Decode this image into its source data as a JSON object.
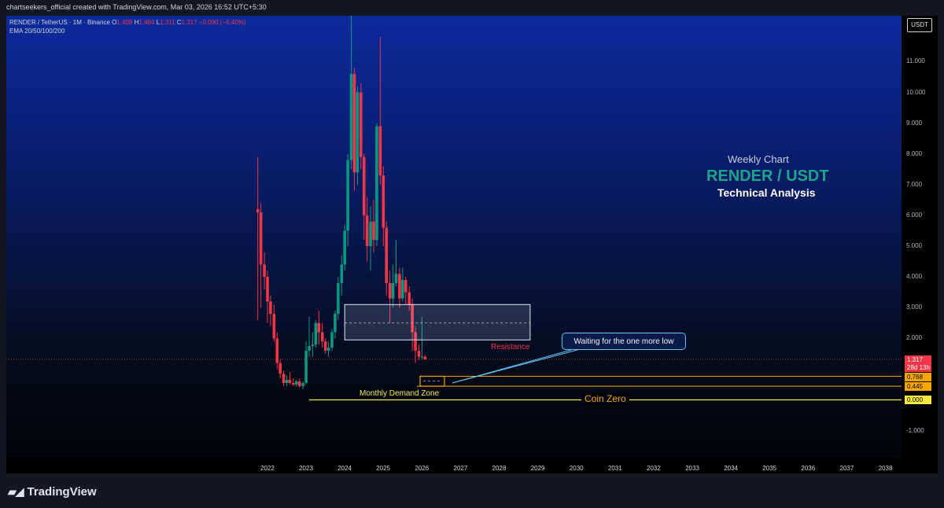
{
  "header": {
    "caption": "chartseekers_official created with TradingView.com, Mar 03, 2026 16:52 UTC+5:30",
    "legend_symbol": "RENDER / TetherUS · 1M · Binance",
    "legend_o": "O",
    "legend_o_val": "1.408",
    "legend_h": "H",
    "legend_h_val": "1.464",
    "legend_l": "L",
    "legend_l_val": "1.311",
    "legend_c": "C",
    "legend_c_val": "1.317 −0.090 (−6.40%)",
    "indicator": "EMA 20/50/100/200"
  },
  "currency_label": "USDT",
  "price_tags": {
    "last_price": "1.317",
    "countdown": "28d 13h",
    "zone_top": "0.768",
    "zone_bottom": "0.445",
    "zero": "0.000"
  },
  "annotations": {
    "weekly": "Weekly Chart",
    "pair": "RENDER / USDT",
    "ta": "Technical Analysis",
    "resistance": "Resistance",
    "callout": "Waiting for the one more low",
    "demand": "Monthly Demand Zone",
    "coin_zero": "Coin Zero"
  },
  "footer": {
    "brand": "TradingView"
  },
  "colors": {
    "up": "#089981",
    "down": "#f23645",
    "zone": "#f7a600",
    "zero_line": "#f5e642",
    "callout_border": "#60c3ef",
    "pair_title": "#1fa38a"
  },
  "chart_data": {
    "type": "candlestick",
    "symbol": "RENDER / TetherUS",
    "interval": "1M",
    "exchange": "Binance",
    "ylim": [
      -1.5,
      12.5
    ],
    "y_ticks": [
      "11.000",
      "10.000",
      "9.000",
      "8.000",
      "7.000",
      "6.000",
      "5.000",
      "4.000",
      "3.000",
      "2.000",
      "-1.000"
    ],
    "x_ticks": [
      "2022",
      "2023",
      "2024",
      "2025",
      "2026",
      "2027",
      "2028",
      "2029",
      "2030",
      "2031",
      "2032",
      "2033",
      "2034",
      "2035",
      "2036",
      "2037",
      "2038"
    ],
    "candles": [
      {
        "t": 2021.75,
        "o": 6.2,
        "h": 7.9,
        "l": 2.6,
        "c": 6.1
      },
      {
        "t": 2021.83,
        "o": 6.1,
        "h": 6.4,
        "l": 3.0,
        "c": 4.4
      },
      {
        "t": 2021.92,
        "o": 4.4,
        "h": 4.8,
        "l": 3.6,
        "c": 4.0
      },
      {
        "t": 2022.0,
        "o": 4.0,
        "h": 4.2,
        "l": 2.5,
        "c": 3.2
      },
      {
        "t": 2022.08,
        "o": 3.2,
        "h": 3.4,
        "l": 2.4,
        "c": 2.8
      },
      {
        "t": 2022.17,
        "o": 2.8,
        "h": 3.1,
        "l": 1.9,
        "c": 2.0
      },
      {
        "t": 2022.25,
        "o": 2.0,
        "h": 2.2,
        "l": 1.0,
        "c": 1.2
      },
      {
        "t": 2022.33,
        "o": 1.2,
        "h": 1.3,
        "l": 0.7,
        "c": 0.85
      },
      {
        "t": 2022.42,
        "o": 0.85,
        "h": 0.95,
        "l": 0.45,
        "c": 0.55
      },
      {
        "t": 2022.5,
        "o": 0.55,
        "h": 0.8,
        "l": 0.45,
        "c": 0.65
      },
      {
        "t": 2022.58,
        "o": 0.65,
        "h": 0.9,
        "l": 0.5,
        "c": 0.55
      },
      {
        "t": 2022.67,
        "o": 0.55,
        "h": 0.7,
        "l": 0.45,
        "c": 0.5
      },
      {
        "t": 2022.75,
        "o": 0.5,
        "h": 0.65,
        "l": 0.42,
        "c": 0.6
      },
      {
        "t": 2022.83,
        "o": 0.6,
        "h": 0.7,
        "l": 0.4,
        "c": 0.45
      },
      {
        "t": 2022.92,
        "o": 0.45,
        "h": 0.6,
        "l": 0.35,
        "c": 0.55
      },
      {
        "t": 2023.0,
        "o": 0.55,
        "h": 1.9,
        "l": 0.5,
        "c": 1.6
      },
      {
        "t": 2023.08,
        "o": 1.6,
        "h": 2.7,
        "l": 1.4,
        "c": 1.75
      },
      {
        "t": 2023.17,
        "o": 1.75,
        "h": 2.2,
        "l": 1.4,
        "c": 1.8
      },
      {
        "t": 2023.25,
        "o": 1.8,
        "h": 2.6,
        "l": 1.7,
        "c": 2.5
      },
      {
        "t": 2023.33,
        "o": 2.5,
        "h": 2.9,
        "l": 1.8,
        "c": 2.2
      },
      {
        "t": 2023.42,
        "o": 2.2,
        "h": 2.5,
        "l": 1.7,
        "c": 1.9
      },
      {
        "t": 2023.5,
        "o": 1.9,
        "h": 2.0,
        "l": 1.5,
        "c": 1.6
      },
      {
        "t": 2023.58,
        "o": 1.6,
        "h": 1.9,
        "l": 1.4,
        "c": 1.7
      },
      {
        "t": 2023.67,
        "o": 1.7,
        "h": 2.3,
        "l": 1.6,
        "c": 2.2
      },
      {
        "t": 2023.75,
        "o": 2.2,
        "h": 2.9,
        "l": 2.0,
        "c": 2.8
      },
      {
        "t": 2023.83,
        "o": 2.8,
        "h": 4.0,
        "l": 2.6,
        "c": 3.8
      },
      {
        "t": 2023.92,
        "o": 3.8,
        "h": 4.7,
        "l": 3.4,
        "c": 4.4
      },
      {
        "t": 2024.0,
        "o": 4.4,
        "h": 5.7,
        "l": 4.2,
        "c": 5.5
      },
      {
        "t": 2024.08,
        "o": 5.5,
        "h": 8.0,
        "l": 5.0,
        "c": 7.8
      },
      {
        "t": 2024.17,
        "o": 7.8,
        "h": 12.5,
        "l": 7.5,
        "c": 10.6
      },
      {
        "t": 2024.25,
        "o": 10.6,
        "h": 10.8,
        "l": 6.8,
        "c": 7.4
      },
      {
        "t": 2024.33,
        "o": 7.4,
        "h": 10.2,
        "l": 7.0,
        "c": 10.0
      },
      {
        "t": 2024.42,
        "o": 10.0,
        "h": 10.3,
        "l": 7.5,
        "c": 7.9
      },
      {
        "t": 2024.5,
        "o": 7.9,
        "h": 8.0,
        "l": 5.2,
        "c": 6.0
      },
      {
        "t": 2024.58,
        "o": 6.0,
        "h": 6.6,
        "l": 4.5,
        "c": 5.0
      },
      {
        "t": 2024.67,
        "o": 5.0,
        "h": 6.3,
        "l": 4.2,
        "c": 5.8
      },
      {
        "t": 2024.75,
        "o": 5.8,
        "h": 6.5,
        "l": 4.8,
        "c": 5.2
      },
      {
        "t": 2024.83,
        "o": 5.2,
        "h": 9.0,
        "l": 5.0,
        "c": 8.9
      },
      {
        "t": 2024.92,
        "o": 8.9,
        "h": 11.8,
        "l": 7.0,
        "c": 7.3
      },
      {
        "t": 2025.0,
        "o": 7.3,
        "h": 7.6,
        "l": 5.0,
        "c": 5.6
      },
      {
        "t": 2025.08,
        "o": 5.6,
        "h": 5.8,
        "l": 3.4,
        "c": 3.8
      },
      {
        "t": 2025.17,
        "o": 3.8,
        "h": 4.2,
        "l": 2.5,
        "c": 3.3
      },
      {
        "t": 2025.25,
        "o": 3.3,
        "h": 4.4,
        "l": 3.0,
        "c": 3.8
      },
      {
        "t": 2025.33,
        "o": 3.8,
        "h": 5.2,
        "l": 3.7,
        "c": 4.1
      },
      {
        "t": 2025.42,
        "o": 4.1,
        "h": 4.3,
        "l": 3.0,
        "c": 3.3
      },
      {
        "t": 2025.5,
        "o": 3.3,
        "h": 4.3,
        "l": 3.2,
        "c": 3.9
      },
      {
        "t": 2025.58,
        "o": 3.9,
        "h": 4.0,
        "l": 3.1,
        "c": 3.5
      },
      {
        "t": 2025.67,
        "o": 3.5,
        "h": 3.7,
        "l": 2.9,
        "c": 3.1
      },
      {
        "t": 2025.75,
        "o": 3.1,
        "h": 3.3,
        "l": 1.6,
        "c": 2.2
      },
      {
        "t": 2025.83,
        "o": 2.2,
        "h": 2.4,
        "l": 1.2,
        "c": 1.6
      },
      {
        "t": 2025.92,
        "o": 1.6,
        "h": 1.8,
        "l": 1.3,
        "c": 1.4
      },
      {
        "t": 2026.0,
        "o": 1.4,
        "h": 2.7,
        "l": 1.3,
        "c": 1.408
      },
      {
        "t": 2026.08,
        "o": 1.408,
        "h": 1.464,
        "l": 1.311,
        "c": 1.317
      }
    ],
    "resistance_zone": {
      "x_from": 2024.0,
      "x_to": 2028.8,
      "top": 3.1,
      "bottom": 1.95,
      "mid": 2.5
    },
    "demand_zone": {
      "top": 0.768,
      "bottom": 0.445
    },
    "last_price": 1.317,
    "coin_zero_level": 0.0
  }
}
